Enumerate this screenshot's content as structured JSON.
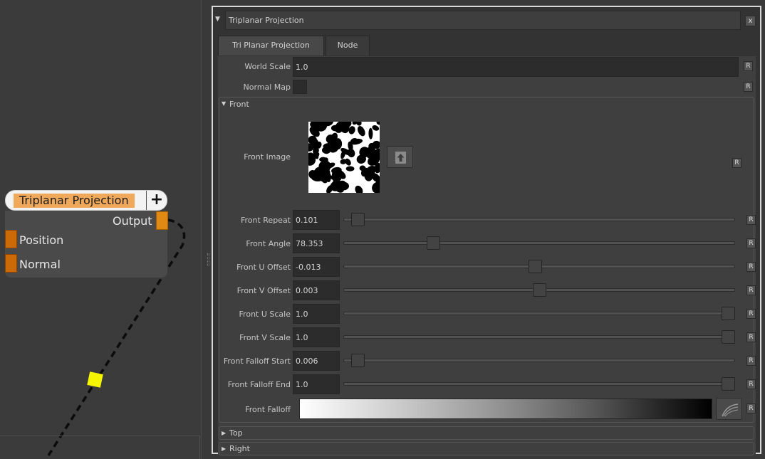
{
  "graph": {
    "node": {
      "title": "Triplanar Projection",
      "add_symbol": "+",
      "output_label": "Output",
      "inputs": [
        "Position",
        "Normal"
      ]
    },
    "colors": {
      "node_title_bg": "#f0a85a",
      "port": "#e08a14",
      "knob": "#f5f500"
    }
  },
  "panel": {
    "title": "Triplanar Projection",
    "close_label": "x",
    "tabs": [
      {
        "label": "Tri Planar Projection",
        "active": true
      },
      {
        "label": "Node",
        "active": false
      }
    ],
    "reset_label": "R",
    "world_scale": {
      "label": "World Scale",
      "value": "1.0"
    },
    "normal_map": {
      "label": "Normal Map"
    },
    "front": {
      "section_label": "Front",
      "image_label": "Front Image",
      "params": [
        {
          "label": "Front Repeat",
          "value": "0.101",
          "slider": 0.02
        },
        {
          "label": "Front Angle",
          "value": "78.353",
          "slider": 0.22
        },
        {
          "label": "Front U Offset",
          "value": "-0.013",
          "slider": 0.49
        },
        {
          "label": "Front V Offset",
          "value": "0.003",
          "slider": 0.5
        },
        {
          "label": "Front U Scale",
          "value": "1.0",
          "slider": 1.0
        },
        {
          "label": "Front V Scale",
          "value": "1.0",
          "slider": 1.0
        },
        {
          "label": "Front Falloff Start",
          "value": "0.006",
          "slider": 0.02
        },
        {
          "label": "Front Falloff End",
          "value": "1.0",
          "slider": 1.0
        }
      ],
      "falloff_label": "Front Falloff"
    },
    "collapsed_sections": [
      "Top",
      "Right"
    ]
  }
}
